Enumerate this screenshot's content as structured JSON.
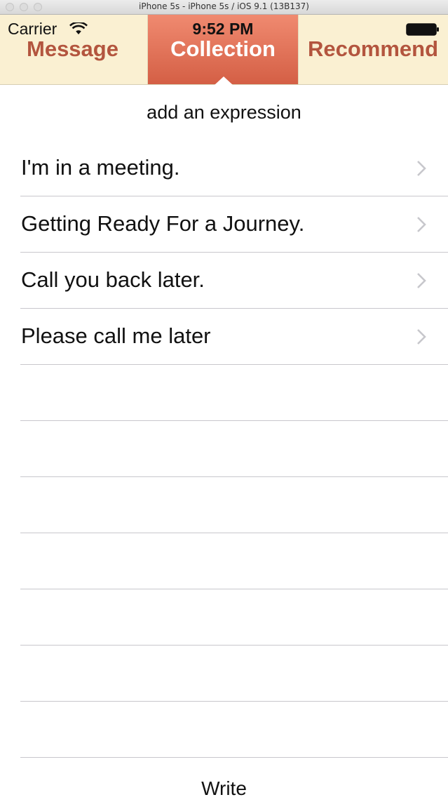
{
  "window": {
    "title": "iPhone 5s - iPhone 5s / iOS 9.1 (13B137)"
  },
  "status_bar": {
    "carrier": "Carrier",
    "time": "9:52 PM",
    "icons": [
      "wifi-icon",
      "battery-icon"
    ]
  },
  "tabs": [
    {
      "label": "Message",
      "selected": false
    },
    {
      "label": "Collection",
      "selected": true
    },
    {
      "label": "Recommend",
      "selected": false
    }
  ],
  "header": {
    "add_label": "add an expression"
  },
  "expressions": [
    {
      "text": "I'm in a meeting."
    },
    {
      "text": "Getting Ready For a Journey."
    },
    {
      "text": "Call you back later."
    },
    {
      "text": "Please call me later"
    }
  ],
  "empty_rows": 7,
  "footer": {
    "write_label": "Write"
  },
  "colors": {
    "tabbar_bg": "#faf0d2",
    "tab_text": "#b3553e",
    "tab_selected_bg": "#e06a4f",
    "tab_selected_text": "#ffffff",
    "separator": "#c8c7cc",
    "chevron": "#c7c7cc"
  }
}
